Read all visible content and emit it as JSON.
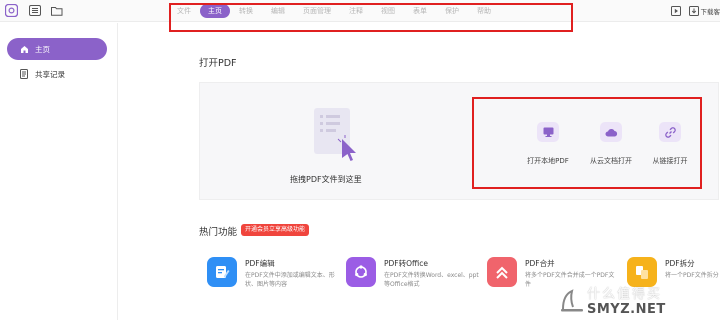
{
  "topbar": {
    "menu_tabs": [
      {
        "label": "文件",
        "active": false
      },
      {
        "label": "主页",
        "active": true
      },
      {
        "label": "转换",
        "active": false
      },
      {
        "label": "编辑",
        "active": false
      },
      {
        "label": "页面管理",
        "active": false
      },
      {
        "label": "注释",
        "active": false
      },
      {
        "label": "视图",
        "active": false
      },
      {
        "label": "表单",
        "active": false
      },
      {
        "label": "保护",
        "active": false
      },
      {
        "label": "帮助",
        "active": false
      }
    ],
    "download_label": "下载客"
  },
  "sidebar": {
    "items": [
      {
        "label": "主页",
        "icon": "home-icon",
        "active": true
      },
      {
        "label": "共享记录",
        "icon": "document-icon",
        "active": false
      }
    ]
  },
  "open_pdf": {
    "title": "打开PDF",
    "drop_label": "拖拽PDF文件到这里",
    "actions": [
      {
        "label": "打开本地PDF",
        "icon": "monitor-icon"
      },
      {
        "label": "从云文档打开",
        "icon": "cloud-icon"
      },
      {
        "label": "从链接打开",
        "icon": "link-icon"
      }
    ]
  },
  "hot": {
    "title": "热门功能",
    "badge": "开通会员立享高级功能",
    "features": [
      {
        "title": "PDF编辑",
        "desc": "在PDF文件中添加或编辑文本、形状、图片等内容",
        "icon": "edit-icon",
        "color": "#2f8ff5"
      },
      {
        "title": "PDF转Office",
        "desc": "在PDF文件转换Word、excel、ppt等Office格式",
        "icon": "convert-icon",
        "color": "#9b5de5"
      },
      {
        "title": "PDF合并",
        "desc": "将多个PDF文件合并成一个PDF文件",
        "icon": "merge-icon",
        "color": "#f0646c"
      },
      {
        "title": "PDF拆分",
        "desc": "将一个PDF文件拆分",
        "icon": "split-icon",
        "color": "#f6b21b"
      }
    ]
  },
  "watermark": {
    "top": "什么值得买",
    "bottom": "SMYZ.NET"
  },
  "colors": {
    "accent": "#8b62c9",
    "highlight_box": "#e02020"
  }
}
